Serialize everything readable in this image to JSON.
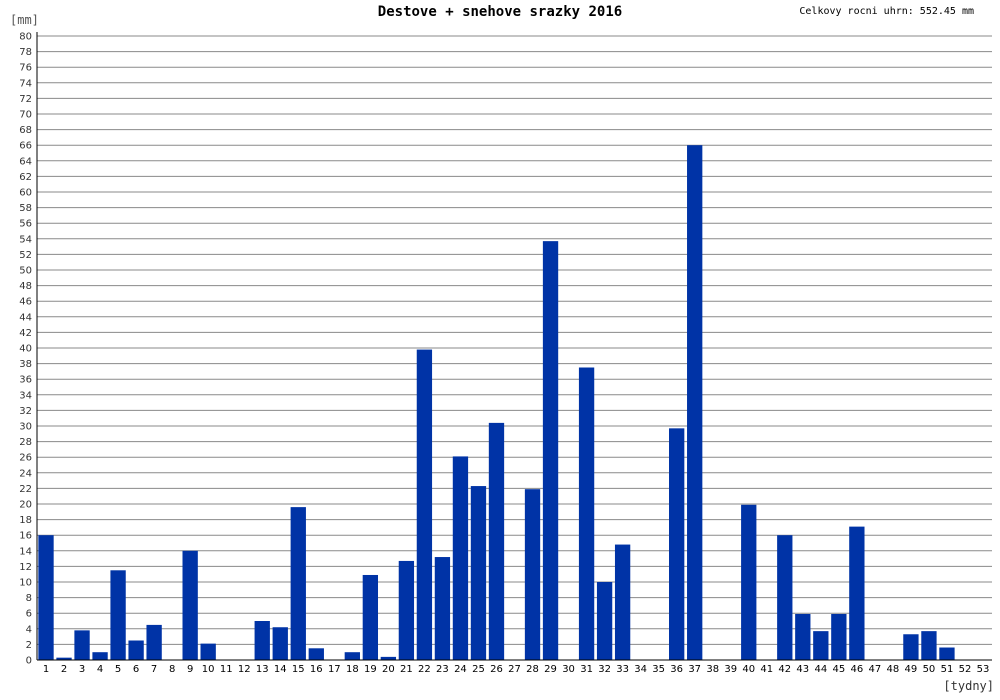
{
  "header": {
    "title": "Destove + snehove srazky 2016",
    "total_label": "Celkovy rocni uhrn: 552.45 mm"
  },
  "chart_data": {
    "type": "bar",
    "title": "Destove + snehove srazky 2016",
    "ylabel": "[mm]",
    "xlabel": "[tydny]",
    "ylim": [
      0,
      80
    ],
    "ytick_step": 2,
    "grid": true,
    "bar_color": "#0033a6",
    "categories": [
      "1",
      "2",
      "3",
      "4",
      "5",
      "6",
      "7",
      "8",
      "9",
      "10",
      "11",
      "12",
      "13",
      "14",
      "15",
      "16",
      "17",
      "18",
      "19",
      "20",
      "21",
      "22",
      "23",
      "24",
      "25",
      "26",
      "27",
      "28",
      "29",
      "30",
      "31",
      "32",
      "33",
      "34",
      "35",
      "36",
      "37",
      "38",
      "39",
      "40",
      "41",
      "42",
      "43",
      "44",
      "45",
      "46",
      "47",
      "48",
      "49",
      "50",
      "51",
      "52",
      "53"
    ],
    "values": [
      16.0,
      0.3,
      3.8,
      1.0,
      11.5,
      2.5,
      4.5,
      0,
      14.0,
      2.1,
      0,
      0,
      5.0,
      4.2,
      19.6,
      1.5,
      0,
      1.0,
      10.9,
      0.4,
      12.7,
      39.8,
      13.2,
      26.1,
      22.3,
      30.4,
      0,
      21.9,
      53.7,
      0,
      37.5,
      10.0,
      14.8,
      0,
      0,
      29.7,
      66.0,
      0,
      0,
      19.9,
      0,
      16.0,
      5.9,
      3.7,
      5.9,
      17.1,
      0,
      0,
      3.3,
      3.7,
      1.6,
      0,
      0
    ]
  }
}
